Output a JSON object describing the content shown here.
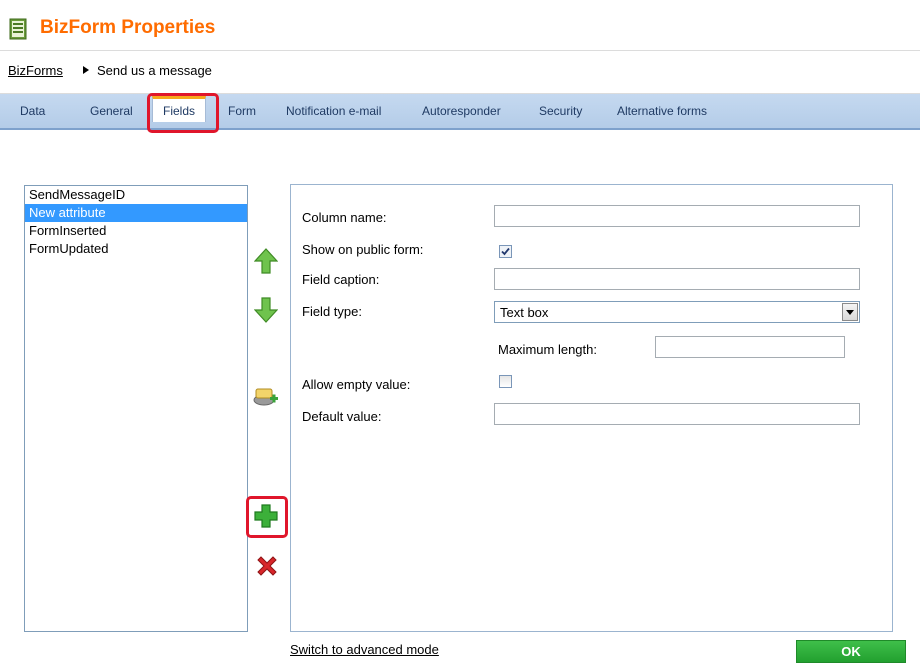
{
  "header": {
    "title": "BizForm Properties",
    "icon": "form-document-icon"
  },
  "breadcrumb": {
    "parent": "BizForms",
    "current": "Send us a message"
  },
  "tabs": [
    {
      "label": "Data"
    },
    {
      "label": "General"
    },
    {
      "label": "Fields",
      "active": true
    },
    {
      "label": "Form"
    },
    {
      "label": "Notification e-mail"
    },
    {
      "label": "Autoresponder"
    },
    {
      "label": "Security"
    },
    {
      "label": "Alternative forms"
    }
  ],
  "fields_list": {
    "items": [
      "SendMessageID",
      "New attribute",
      "FormInserted",
      "FormUpdated"
    ],
    "selected": "New attribute"
  },
  "side_buttons": {
    "move_up": "arrow-up-icon",
    "move_down": "arrow-down-icon",
    "new_category": "new-category-icon",
    "new_attribute": "plus-icon",
    "delete": "delete-x-icon"
  },
  "form": {
    "column_name_label": "Column name:",
    "column_name_value": "",
    "show_on_public_form_label": "Show on public form:",
    "show_on_public_form_checked": true,
    "field_caption_label": "Field caption:",
    "field_caption_value": "",
    "field_type_label": "Field type:",
    "field_type_value": "Text box",
    "max_length_label": "Maximum length:",
    "max_length_value": "",
    "allow_empty_label": "Allow empty value:",
    "allow_empty_checked": false,
    "default_value_label": "Default value:",
    "default_value_value": ""
  },
  "footer": {
    "switch_link": "Switch to advanced mode",
    "ok_label": "OK"
  },
  "colors": {
    "title": "#ff6c00",
    "tab_bar": "#c5d9f0",
    "active_tab_accent": "#f7a71c",
    "highlight": "#e0162b",
    "selection": "#3399ff",
    "ok_button": "#2eaf3a"
  }
}
